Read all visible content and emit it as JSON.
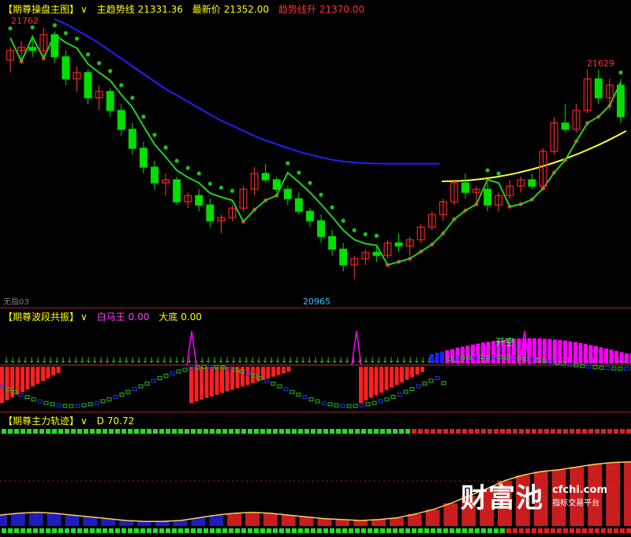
{
  "panel1": {
    "name": "【期尊操盘主图】",
    "arrow": "∨",
    "main_trend_label": "主趋势线",
    "main_trend_value": "21331.36",
    "latest_label": "最新价",
    "latest_value": "21352.00",
    "trend_up_label": "趋势线升",
    "trend_up_value": "21370.00",
    "high_left": "21762",
    "high_right": "21629",
    "low_mark": "20965",
    "corner_label": "无指03"
  },
  "panel2": {
    "name": "【期尊波段共振】",
    "arrow": "∨",
    "white_horse_label": "白马王",
    "white_horse_value": "0.00",
    "big_bottom_label": "大底",
    "big_bottom_value": "0.00",
    "signal_text": "开空"
  },
  "panel3": {
    "name": "【期尊主力轨迹】",
    "arrow": "∨",
    "d_label": "D",
    "d_value": "70.72"
  },
  "watermark": {
    "logo": "财富池",
    "url": "cfchi.com",
    "subtitle": "指标交易平台"
  },
  "colors": {
    "up": "#ff2020",
    "down": "#00e000",
    "blue_line": "#2020ff",
    "yellow_line": "#ffff30",
    "magenta": "#ff00ff",
    "background": "#000000"
  },
  "chart_data": [
    {
      "type": "candlestick",
      "title": "【期尊操盘主图】",
      "ylim": [
        20900,
        21800
      ],
      "annotations": [
        "21762",
        "21629",
        "20965"
      ],
      "series": [
        {
          "name": "主趋势线",
          "values": [
            21790,
            21770,
            21745,
            21720,
            21690,
            21660,
            21630,
            21600,
            21570,
            21545,
            21520,
            21495,
            21470,
            21450,
            21430,
            21410,
            21395,
            21380,
            21366,
            21355,
            21345,
            21338,
            21334,
            21332,
            21331,
            21331,
            21331,
            21331,
            21331
          ]
        },
        {
          "name": "趋势线升",
          "values": [
            21370
          ]
        }
      ],
      "ohlc": [
        [
          21660,
          21700,
          21620,
          21690
        ],
        [
          21690,
          21720,
          21660,
          21700
        ],
        [
          21700,
          21740,
          21670,
          21690
        ],
        [
          21690,
          21762,
          21660,
          21740
        ],
        [
          21740,
          21750,
          21650,
          21670
        ],
        [
          21670,
          21690,
          21580,
          21600
        ],
        [
          21600,
          21640,
          21560,
          21620
        ],
        [
          21620,
          21630,
          21520,
          21540
        ],
        [
          21540,
          21580,
          21500,
          21560
        ],
        [
          21560,
          21570,
          21480,
          21500
        ],
        [
          21500,
          21520,
          21420,
          21440
        ],
        [
          21440,
          21460,
          21360,
          21380
        ],
        [
          21380,
          21400,
          21300,
          21320
        ],
        [
          21320,
          21340,
          21250,
          21270
        ],
        [
          21270,
          21300,
          21230,
          21280
        ],
        [
          21280,
          21290,
          21200,
          21210
        ],
        [
          21210,
          21240,
          21190,
          21230
        ],
        [
          21230,
          21250,
          21180,
          21200
        ],
        [
          21200,
          21220,
          21130,
          21150
        ],
        [
          21150,
          21170,
          21110,
          21160
        ],
        [
          21160,
          21200,
          21150,
          21190
        ],
        [
          21190,
          21260,
          21180,
          21250
        ],
        [
          21250,
          21320,
          21230,
          21300
        ],
        [
          21300,
          21330,
          21270,
          21280
        ],
        [
          21280,
          21290,
          21240,
          21250
        ],
        [
          21250,
          21260,
          21200,
          21220
        ],
        [
          21220,
          21240,
          21170,
          21180
        ],
        [
          21180,
          21190,
          21130,
          21150
        ],
        [
          21150,
          21170,
          21080,
          21100
        ],
        [
          21100,
          21120,
          21040,
          21060
        ],
        [
          21060,
          21080,
          20990,
          21010
        ],
        [
          21010,
          21040,
          20965,
          21030
        ],
        [
          21030,
          21060,
          21010,
          21050
        ],
        [
          21050,
          21070,
          21020,
          21040
        ],
        [
          21040,
          21090,
          21030,
          21080
        ],
        [
          21080,
          21110,
          21050,
          21070
        ],
        [
          21070,
          21100,
          21040,
          21090
        ],
        [
          21090,
          21140,
          21080,
          21130
        ],
        [
          21130,
          21180,
          21120,
          21170
        ],
        [
          21170,
          21220,
          21150,
          21210
        ],
        [
          21210,
          21280,
          21200,
          21270
        ],
        [
          21270,
          21300,
          21220,
          21240
        ],
        [
          21240,
          21260,
          21200,
          21250
        ],
        [
          21250,
          21270,
          21180,
          21200
        ],
        [
          21200,
          21240,
          21180,
          21230
        ],
        [
          21230,
          21280,
          21220,
          21260
        ],
        [
          21260,
          21290,
          21240,
          21280
        ],
        [
          21280,
          21300,
          21250,
          21260
        ],
        [
          21260,
          21380,
          21250,
          21370
        ],
        [
          21370,
          21480,
          21360,
          21460
        ],
        [
          21460,
          21520,
          21430,
          21440
        ],
        [
          21440,
          21520,
          21430,
          21500
        ],
        [
          21500,
          21629,
          21490,
          21600
        ],
        [
          21600,
          21629,
          21520,
          21540
        ],
        [
          21540,
          21600,
          21500,
          21580
        ],
        [
          21580,
          21600,
          21460,
          21480
        ]
      ]
    },
    {
      "type": "bar",
      "title": "【期尊波段共振】",
      "series": [
        {
          "name": "白马王",
          "values": [
            0.0
          ]
        },
        {
          "name": "大底",
          "values": [
            0.0
          ]
        }
      ]
    },
    {
      "type": "line",
      "title": "【期尊主力轨迹】",
      "series": [
        {
          "name": "D",
          "values": [
            12,
            14,
            15,
            14,
            12,
            10,
            8,
            6,
            5,
            5,
            6,
            9,
            12,
            14,
            15,
            14,
            12,
            10,
            8,
            7,
            6,
            7,
            9,
            13,
            18,
            25,
            33,
            41,
            50,
            56,
            60,
            62,
            65,
            68,
            70,
            70.72
          ]
        }
      ]
    }
  ]
}
